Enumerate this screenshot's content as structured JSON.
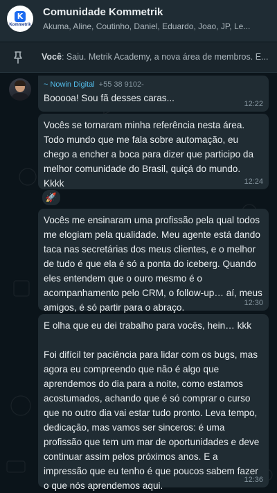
{
  "header": {
    "title": "Comunidade Kommetrik",
    "members": "Akuma, Aline, Coutinho, Daniel, Eduardo, Joao, JP, Le...",
    "logo_text": "Kommetrik",
    "logo_letter": "K"
  },
  "pinned": {
    "sender": "Você",
    "text": ": Saiu. Metrik Academy, a nova área de membros. E..."
  },
  "messages": [
    {
      "sender": "~ Nowin Digital",
      "phone": "+55 38 9102-",
      "text": "Booooa! Sou fã desses caras...",
      "time": "12:22"
    },
    {
      "text": "Vocês se tornaram minha referência nesta área. Todo mundo que me fala sobre automação, eu chego a encher a boca para dizer que participo da melhor comunidade do Brasil, quiçá do mundo. Kkkk",
      "time": "12:24",
      "reaction": "🚀"
    },
    {
      "text": "Vocês me ensinaram uma profissão pela qual todos me elogiam pela qualidade. Meu agente está dando taca nas secretárias dos meus clientes, e o melhor de tudo é que ela é só a ponta do iceberg. Quando eles entendem que o ouro mesmo é o acompanhamento pelo CRM, o follow-up… aí, meus amigos, é só partir para o abraço.",
      "time": "12:30"
    },
    {
      "text": "E olha que eu dei trabalho para vocês, hein… kkk\n\nFoi difícil ter paciência para lidar com os bugs, mas agora eu compreendo que não é algo que aprendemos do dia para a noite, como estamos acostumados, achando que é só comprar o curso que no outro dia vai estar tudo pronto. Leva tempo, dedicação, mas vamos ser sinceros: é uma profissão que tem um mar de oportunidades e deve continuar assim pelos próximos anos. E a impressão que eu tenho é que poucos sabem fazer o que nós aprendemos aqui.",
      "time": "12:36"
    }
  ],
  "colors": {
    "background": "#0b141a",
    "header": "#1f2c34",
    "bubble": "#202c33",
    "sender_name": "#53bdeb",
    "accent_logo": "#1d6bf0"
  },
  "icons": [
    "pin-icon",
    "rocket-reaction"
  ]
}
